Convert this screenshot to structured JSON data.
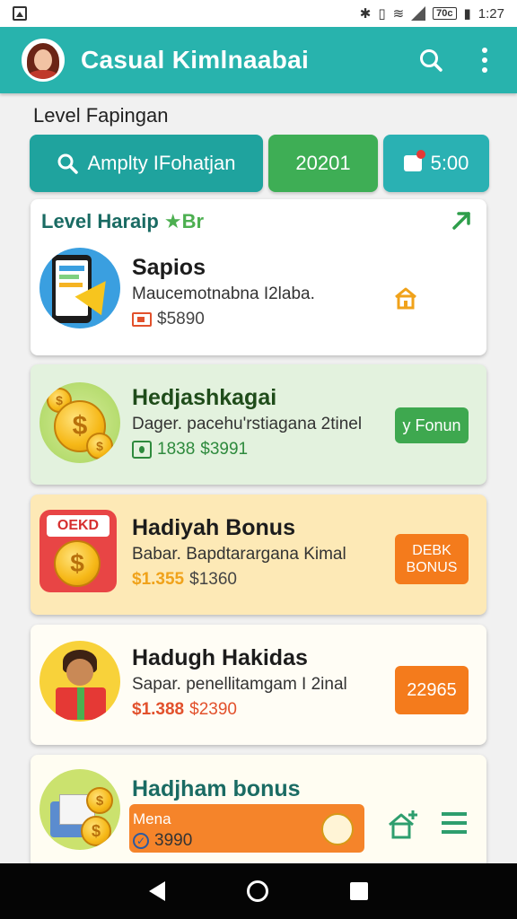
{
  "status_bar": {
    "time": "1:27",
    "battery_label": "70c"
  },
  "app_bar": {
    "title": "Casual Kimlnaabai"
  },
  "section": {
    "heading": "Level Fapingan"
  },
  "top_buttons": {
    "search_label": "Amplty IFohatjan",
    "middle_label": "20201",
    "gift_label": "5:00"
  },
  "cards": [
    {
      "header": "Level Haraip",
      "header_suffix": "Br",
      "title": "Sapios",
      "desc": "Maucemotnabna I2laba.",
      "price": "$5890",
      "accent": "#3a9fe0"
    },
    {
      "title": "Hedjashkagai",
      "desc": "Dager. pacehu'rstiagana 2tinel",
      "count": "1838",
      "price": "$3991",
      "button": "y Fonun",
      "accent": "#3ea84f"
    },
    {
      "title": "Hadiyah Bonus",
      "desc": "Babar. Bapdtarargana Kimal",
      "old_price": "$1.355",
      "price": "$1360",
      "badge": "OEKD",
      "button": "DEBK BONUS",
      "accent": "#f47b1c"
    },
    {
      "title": "Hadugh Hakidas",
      "desc": "Sapar. penellitamgam I 2inal",
      "old_price": "$1.388",
      "price": "$2390",
      "button": "22965",
      "accent": "#f47b1c"
    },
    {
      "title": "Hadjham bonus",
      "bar_label": "Mena",
      "price": "3990",
      "accent": "#f5842a"
    }
  ]
}
